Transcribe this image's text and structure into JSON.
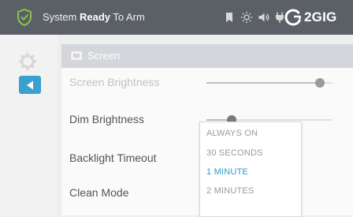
{
  "status_bar": {
    "status_prefix": "System ",
    "status_main": "Ready",
    "status_suffix": " To Arm",
    "icons": [
      "shield-check-icon",
      "bookmark-icon",
      "brightness-icon",
      "volume-icon",
      "plug-icon"
    ],
    "logo_text": "2GIG",
    "accent": "#8bc34a"
  },
  "nav": {
    "back_icon": "back-arrow-icon",
    "settings_icon": "gear-icon",
    "accent": "#3aa0cf"
  },
  "section": {
    "title": "Screen",
    "icon": "screen-icon"
  },
  "settings": {
    "screen_brightness": {
      "label": "Screen Brightness",
      "level": 0.9
    },
    "dim_brightness": {
      "label": "Dim Brightness",
      "level": 0.2
    },
    "backlight_timeout": {
      "label": "Backlight Timeout"
    },
    "clean_mode": {
      "label": "Clean Mode"
    }
  },
  "backlight_dropdown": {
    "options": [
      "ALWAYS ON",
      "30 SECONDS",
      "1 MINUTE",
      "2 MINUTES"
    ],
    "selected": "1 MINUTE",
    "selected_color": "#2f9ad1"
  }
}
